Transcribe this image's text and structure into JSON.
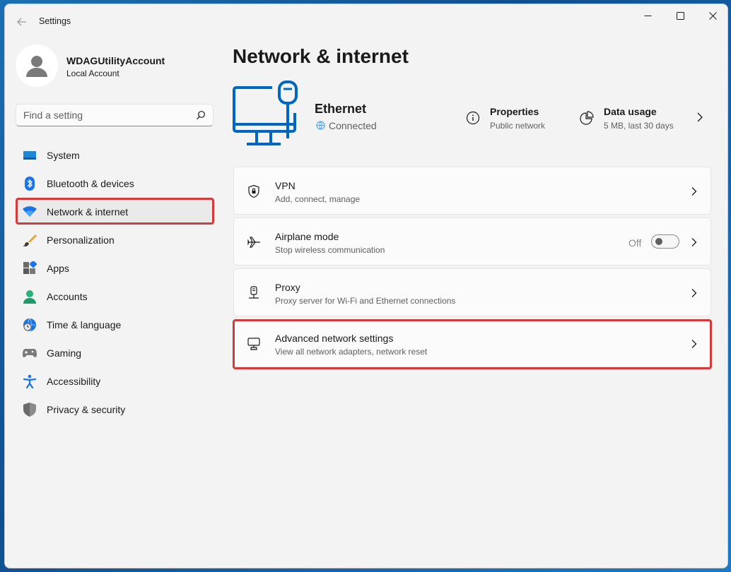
{
  "window": {
    "title": "Settings",
    "controls": {
      "minimize": "—",
      "maximize": "☐",
      "close": "✕"
    }
  },
  "user": {
    "name": "WDAGUtilityAccount",
    "account_type": "Local Account"
  },
  "search": {
    "placeholder": "Find a setting"
  },
  "sidebar": {
    "items": [
      {
        "label": "System",
        "icon": "system-icon",
        "active": false
      },
      {
        "label": "Bluetooth & devices",
        "icon": "bluetooth-icon",
        "active": false
      },
      {
        "label": "Network & internet",
        "icon": "wifi-icon",
        "active": true
      },
      {
        "label": "Personalization",
        "icon": "brush-icon",
        "active": false
      },
      {
        "label": "Apps",
        "icon": "apps-icon",
        "active": false
      },
      {
        "label": "Accounts",
        "icon": "accounts-icon",
        "active": false
      },
      {
        "label": "Time & language",
        "icon": "globe-clock-icon",
        "active": false
      },
      {
        "label": "Gaming",
        "icon": "gamepad-icon",
        "active": false
      },
      {
        "label": "Accessibility",
        "icon": "accessibility-icon",
        "active": false
      },
      {
        "label": "Privacy & security",
        "icon": "shield-icon",
        "active": false
      }
    ]
  },
  "main": {
    "title": "Network & internet",
    "ethernet": {
      "name": "Ethernet",
      "status": "Connected",
      "properties": {
        "title": "Properties",
        "subtitle": "Public network"
      },
      "data_usage": {
        "title": "Data usage",
        "subtitle": "5 MB, last 30 days"
      }
    },
    "cards": [
      {
        "title": "VPN",
        "subtitle": "Add, connect, manage",
        "icon": "vpn-shield-icon"
      },
      {
        "title": "Airplane mode",
        "subtitle": "Stop wireless communication",
        "icon": "airplane-icon",
        "toggle_label": "Off",
        "toggle_on": false
      },
      {
        "title": "Proxy",
        "subtitle": "Proxy server for Wi-Fi and Ethernet connections",
        "icon": "proxy-icon"
      },
      {
        "title": "Advanced network settings",
        "subtitle": "View all network adapters, network reset",
        "icon": "network-adapter-icon"
      }
    ]
  },
  "colors": {
    "accent": "#0067c0",
    "highlight": "#d23b3b",
    "background": "#f3f3f3",
    "card": "#fbfbfb"
  }
}
